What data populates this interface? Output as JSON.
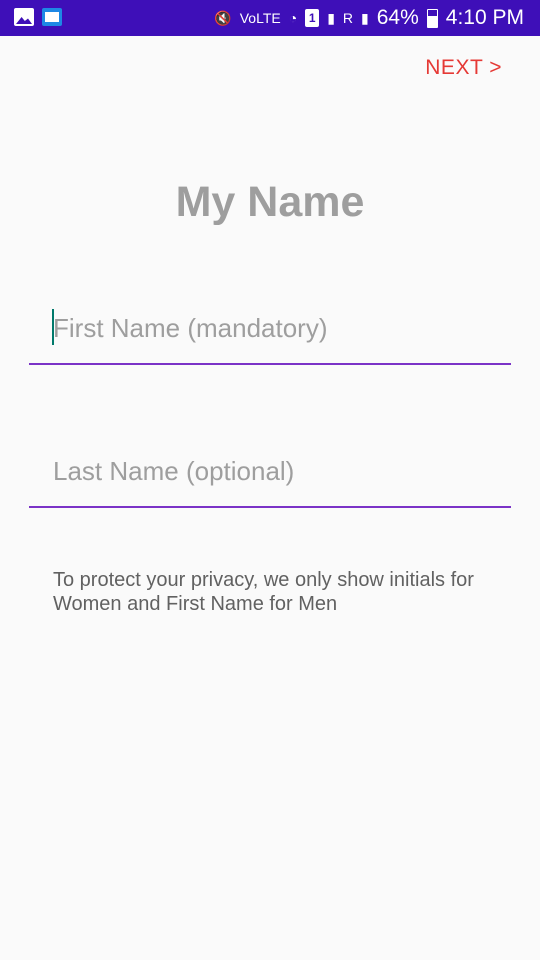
{
  "status_bar": {
    "battery": "64%",
    "time": "4:10 PM",
    "lte_label": "VoLTE",
    "sim_label": "1",
    "roaming_label": "R",
    "icons": [
      "gallery-icon",
      "book-icon",
      "mute-icon",
      "lte-icon",
      "wifi-icon",
      "sim-icon",
      "signal-icon",
      "signal-icon",
      "battery-icon"
    ]
  },
  "header": {
    "next_label": "NEXT >"
  },
  "page": {
    "title": "My Name"
  },
  "form": {
    "first_name": {
      "placeholder": "First Name (mandatory)",
      "value": ""
    },
    "last_name": {
      "placeholder": "Last Name (optional)",
      "value": ""
    }
  },
  "privacy_note": "To protect your privacy, we only show initials for Women and First Name for Men",
  "colors": {
    "status_bar": "#3e0fb8",
    "accent": "#7b33c7",
    "next": "#e53935",
    "title": "#9e9e9e"
  }
}
